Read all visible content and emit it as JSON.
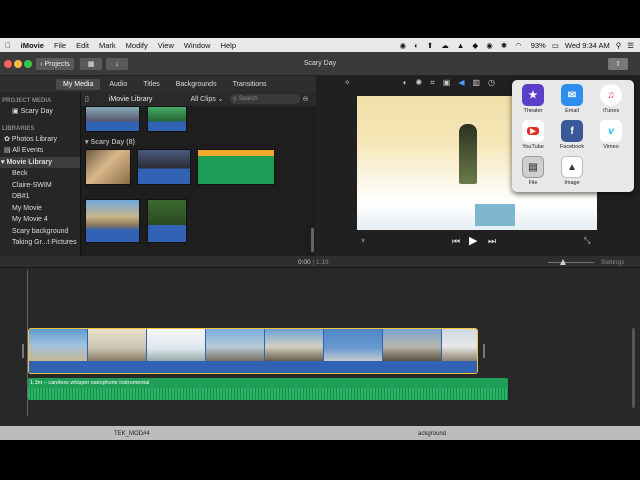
{
  "menubar": {
    "items": [
      "iMovie",
      "File",
      "Edit",
      "Mark",
      "Modify",
      "View",
      "Window",
      "Help"
    ],
    "battery": "93%",
    "clock": "Wed 9:34 AM"
  },
  "toolbar": {
    "projects_label": "Projects",
    "title": "Scary Day"
  },
  "tabs": [
    "My Media",
    "Audio",
    "Titles",
    "Backgrounds",
    "Transitions"
  ],
  "sidebar": {
    "project_media_header": "PROJECT MEDIA",
    "project_item": "Scary Day",
    "libraries_header": "LIBRARIES",
    "photos_library": "Photos Library",
    "all_events": "All Events",
    "movie_library": "Movie Library",
    "events": [
      "Beck",
      "Claire-SWIM",
      "DB#1",
      "My Movie",
      "My Movie 4",
      "Scary background",
      "Taking Gr...t Pictures"
    ]
  },
  "browser": {
    "title": "iMovie Library",
    "filter": "All Clips",
    "search_placeholder": "Search",
    "event_label": "Scary Day",
    "event_count": "(8)"
  },
  "share_popover": {
    "items": [
      {
        "label": "Theater",
        "icon": "theater-icon",
        "color": "#5b3fc9"
      },
      {
        "label": "Email",
        "icon": "email-icon",
        "color": "#2d8ef0"
      },
      {
        "label": "iTunes",
        "icon": "itunes-icon",
        "color": "#ffffff"
      },
      {
        "label": "YouTube",
        "icon": "youtube-icon",
        "color": "#ffffff"
      },
      {
        "label": "Facebook",
        "icon": "facebook-icon",
        "color": "#3b5998"
      },
      {
        "label": "Vimeo",
        "icon": "vimeo-icon",
        "color": "#ffffff"
      },
      {
        "label": "File",
        "icon": "file-icon",
        "color": "#d8d8d8"
      },
      {
        "label": "Image",
        "icon": "image-icon",
        "color": "#ffffff"
      }
    ]
  },
  "timeline": {
    "current_time": "0:00",
    "total_time": "1:19",
    "settings_label": "Settings",
    "audio_clip_label": "1.3m – careless whisper saxophone instrumental"
  },
  "taskbar": {
    "items": [
      "TEK_MOD#4",
      "ackground"
    ]
  }
}
